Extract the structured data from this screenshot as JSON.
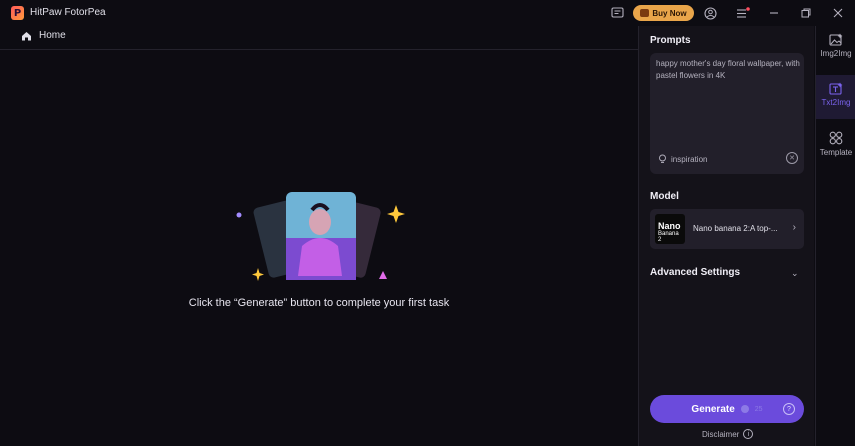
{
  "app": {
    "logo_letter": "P",
    "title": "HitPaw FotorPea"
  },
  "titlebar": {
    "buy_label": "Buy Now",
    "icons": [
      "feedback-icon",
      "cart-icon",
      "account-icon",
      "menu-icon",
      "minimize-icon",
      "restore-icon",
      "close-icon"
    ]
  },
  "nav": {
    "home_label": "Home"
  },
  "empty_state": {
    "message": "Click the “Generate” button to complete your first task"
  },
  "panel": {
    "prompts_title": "Prompts",
    "prompt_text": "happy mother's day floral wallpaper, with pastel flowers in 4K",
    "inspiration_label": "inspiration",
    "model_title": "Model",
    "model": {
      "thumb_line1": "Nano",
      "thumb_line2": "Banana 2",
      "name": "Nano banana 2:A top-..."
    },
    "advanced_title": "Advanced Settings",
    "generate_label": "Generate",
    "credit_count": "25",
    "disclaimer_label": "Disclaimer"
  },
  "rail": {
    "items": [
      {
        "label": "Img2Img",
        "icon": "image-icon",
        "active": false
      },
      {
        "label": "Txt2Img",
        "icon": "text-to-image-icon",
        "active": true
      },
      {
        "label": "Template",
        "icon": "template-grid-icon",
        "active": false
      }
    ]
  },
  "colors": {
    "accent": "#6b4bdc",
    "active_label": "#7b63ee",
    "buy_button": "#e9a54a",
    "background": "#0d0c12",
    "panel": "#141219"
  }
}
